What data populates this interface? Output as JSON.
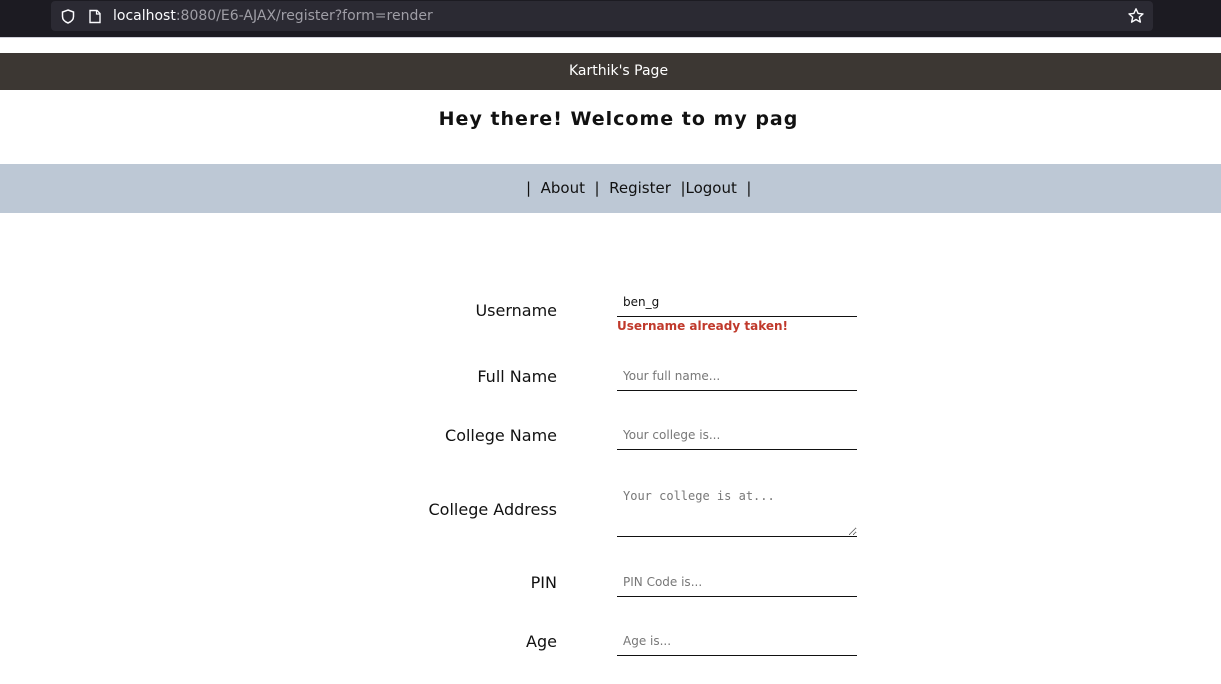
{
  "browser": {
    "url_host": "localhost",
    "url_rest": ":8080/E6-AJAX/register?form=render"
  },
  "site": {
    "header_title": "Karthik's Page",
    "welcome": "Hey there! Welcome to my pag"
  },
  "nav": {
    "sep": "|",
    "about": "About",
    "register": "Register",
    "logout": "Logout"
  },
  "form": {
    "username": {
      "label": "Username",
      "value": "ben_g",
      "error": "Username already taken!"
    },
    "full_name": {
      "label": "Full Name",
      "placeholder": "Your full name..."
    },
    "college_name": {
      "label": "College Name",
      "placeholder": "Your college is..."
    },
    "college_address": {
      "label": "College Address",
      "placeholder": "Your college is at..."
    },
    "pin": {
      "label": "PIN",
      "placeholder": "PIN Code is..."
    },
    "age": {
      "label": "Age",
      "placeholder": "Age is..."
    }
  }
}
